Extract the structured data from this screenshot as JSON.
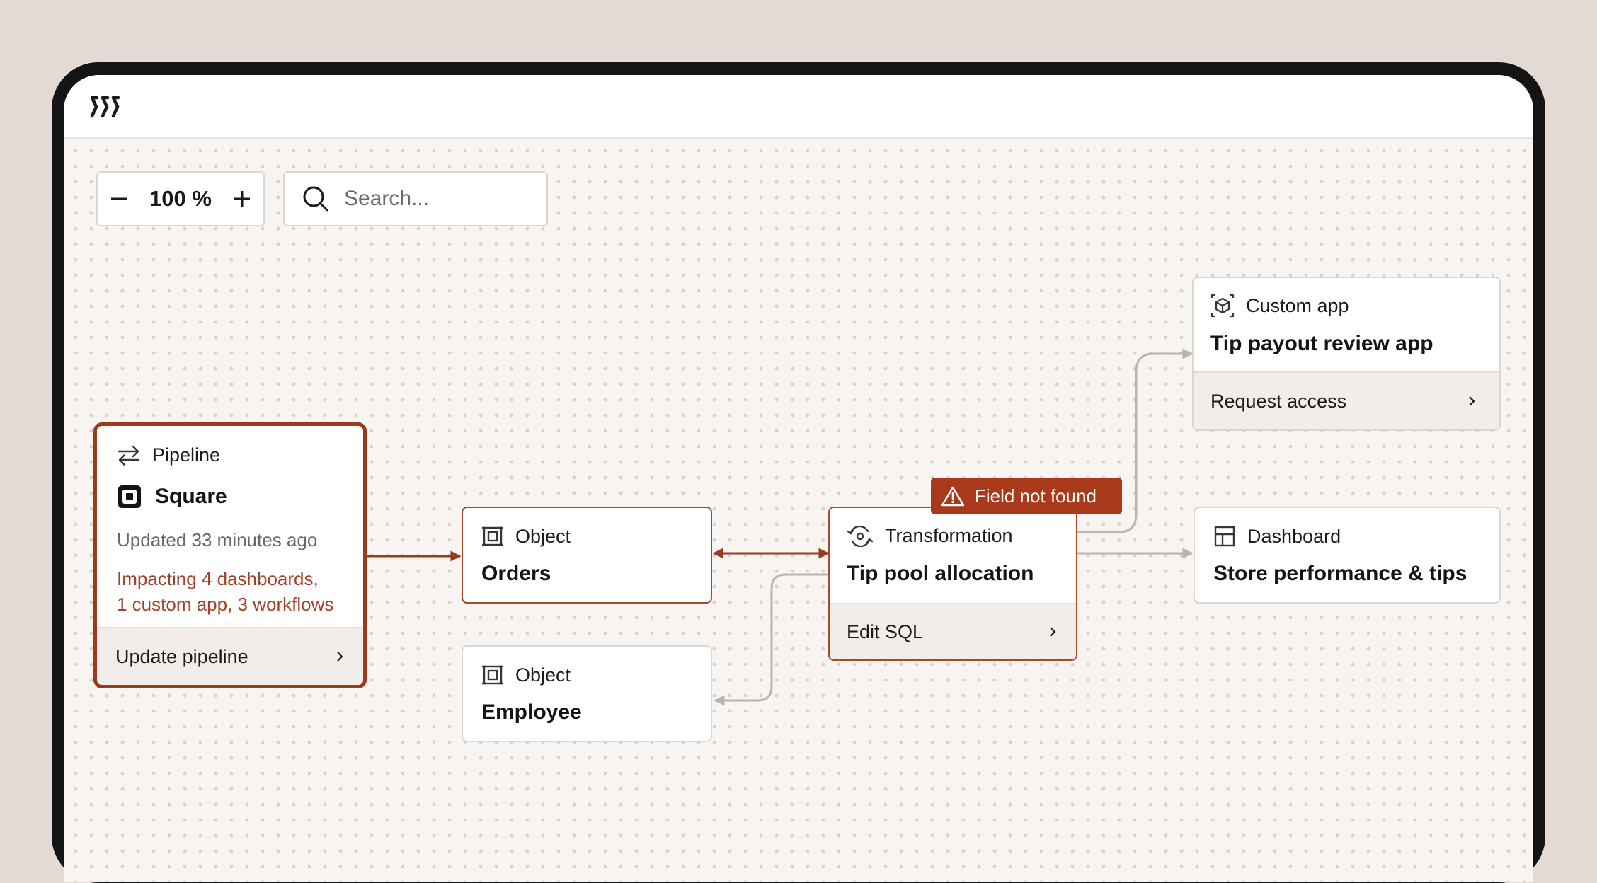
{
  "app": {
    "logo_icon": "logo-icon"
  },
  "toolbar": {
    "zoom_minus_icon": "minus-icon",
    "zoom_value": "100 %",
    "zoom_plus_icon": "plus-icon",
    "search_placeholder": "Search...",
    "search_icon": "search-icon"
  },
  "nodes": {
    "pipeline": {
      "type_label": "Pipeline",
      "type_icon": "arrows-exchange-icon",
      "title": "Square",
      "title_icon": "square-logo-icon",
      "updated": "Updated 33 minutes ago",
      "impact_line1": "Impacting 4 dashboards,",
      "impact_line2": "1 custom app, 3 workflows",
      "action": "Update pipeline"
    },
    "orders": {
      "type_label": "Object",
      "type_icon": "object-icon",
      "title": "Orders"
    },
    "employee": {
      "type_label": "Object",
      "type_icon": "object-icon",
      "title": "Employee"
    },
    "transformation": {
      "type_label": "Transformation",
      "type_icon": "transformation-icon",
      "title": "Tip pool allocation",
      "action": "Edit SQL",
      "error_badge": "Field not found",
      "error_icon": "warning-icon"
    },
    "custom_app": {
      "type_label": "Custom app",
      "type_icon": "cube-icon",
      "title": "Tip payout review app",
      "action": "Request access"
    },
    "dashboard": {
      "type_label": "Dashboard",
      "type_icon": "dashboard-icon",
      "title": "Store performance & tips"
    }
  },
  "colors": {
    "accent": "#9c3a1c",
    "error_badge": "#a8391a",
    "impact_text": "#a0432a",
    "wire_inactive": "#bdb4ad",
    "canvas_bg": "#f7f4f1"
  }
}
